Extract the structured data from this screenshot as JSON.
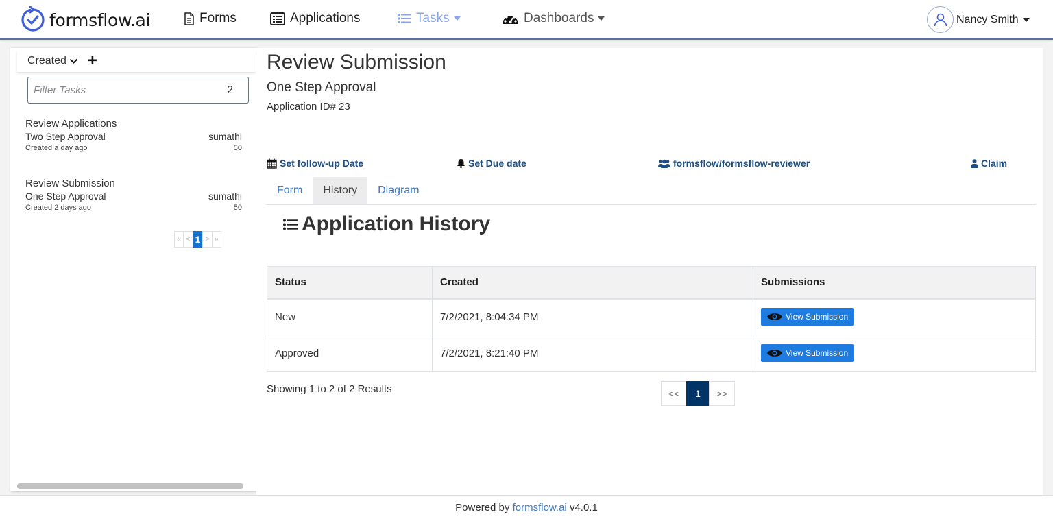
{
  "navbar": {
    "brand": "formsflow.ai",
    "items": [
      {
        "label": "Forms"
      },
      {
        "label": "Applications"
      },
      {
        "label": "Tasks"
      },
      {
        "label": "Dashboards"
      }
    ],
    "user": "Nancy Smith",
    "active_color": "#8aa4e8",
    "brand_color": "#3f5fd8"
  },
  "sidebar": {
    "sort_label": "Created",
    "filter_placeholder": "Filter Tasks",
    "filter_count": "2",
    "tasks": [
      {
        "title": "Review Applications",
        "process": "Two Step Approval",
        "assignee": "sumathi",
        "created": "Created a day ago",
        "priority": "50"
      },
      {
        "title": "Review Submission",
        "process": "One Step Approval",
        "assignee": "sumathi",
        "created": "Created 2 days ago",
        "priority": "50"
      }
    ],
    "pager": {
      "first": "«",
      "prev": "<",
      "current": "1",
      "next": ">",
      "last": "»"
    }
  },
  "task": {
    "title": "Review Submission",
    "subtitle": "One Step Approval",
    "application_id": "Application ID# 23",
    "actions": {
      "followup": "Set follow-up Date",
      "due": "Set Due date",
      "group": "formsflow/formsflow-reviewer",
      "claim": "Claim"
    },
    "tabs": [
      {
        "label": "Form"
      },
      {
        "label": "History"
      },
      {
        "label": "Diagram"
      }
    ],
    "active_tab": "History"
  },
  "history": {
    "heading": "Application History",
    "columns": [
      "Status",
      "Created",
      "Submissions"
    ],
    "rows": [
      {
        "status": "New",
        "created": "7/2/2021, 8:04:34 PM",
        "action": "View Submission"
      },
      {
        "status": "Approved",
        "created": "7/2/2021, 8:21:40 PM",
        "action": "View Submission"
      }
    ],
    "results": "Showing 1 to 2 of 2 Results",
    "pager": {
      "prev": "<<",
      "current": "1",
      "next": ">>"
    },
    "button_color": "#1e7be0"
  },
  "footer": {
    "prefix": "Powered by",
    "link": "formsflow.ai",
    "version": "v4.0.1"
  }
}
